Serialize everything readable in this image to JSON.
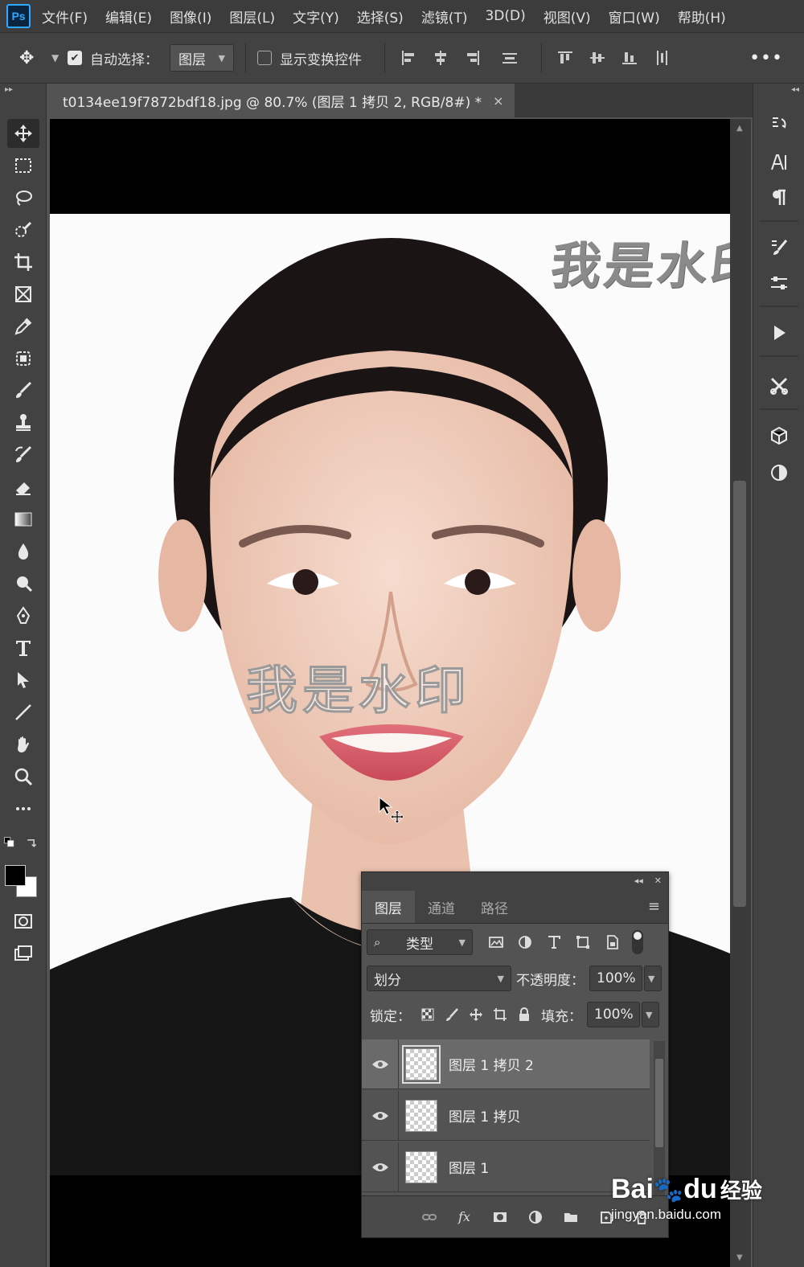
{
  "app": {
    "logo": "Ps"
  },
  "menu": [
    "文件(F)",
    "编辑(E)",
    "图像(I)",
    "图层(L)",
    "文字(Y)",
    "选择(S)",
    "滤镜(T)",
    "3D(D)",
    "视图(V)",
    "窗口(W)",
    "帮助(H)"
  ],
  "options": {
    "auto_select_label": "自动选择：",
    "auto_select_checked": true,
    "auto_select_target": "图层",
    "show_transform_label": "显示变换控件",
    "show_transform_checked": false,
    "more": "•••"
  },
  "document": {
    "tab_title": "t0134ee19f7872bdf18.jpg @ 80.7% (图层 1 拷贝 2, RGB/8#) *",
    "close": "×"
  },
  "canvas": {
    "watermark_top": "我是水印",
    "watermark_face": "我是水印"
  },
  "layers_panel": {
    "tabs": [
      "图层",
      "通道",
      "路径"
    ],
    "active_tab": 0,
    "filter_kind": "类型",
    "blend_mode": "划分",
    "opacity_label": "不透明度：",
    "opacity_value": "100%",
    "lock_label": "锁定：",
    "fill_label": "填充：",
    "fill_value": "100%",
    "layers": [
      {
        "name": "图层 1 拷贝 2",
        "visible": true,
        "selected": true
      },
      {
        "name": "图层 1 拷贝",
        "visible": true,
        "selected": false
      },
      {
        "name": "图层 1",
        "visible": true,
        "selected": false
      }
    ],
    "footer_fx": "fx"
  },
  "site_watermark": {
    "logo": "Bai",
    "logo_suffix": "du",
    "logo_cn": "经验",
    "url": "jingyan.baidu.com"
  },
  "colors": {
    "ps_blue": "#31a8ff",
    "ui_dark": "#424242",
    "ui_mid": "#535353",
    "foreground": "#000000",
    "background": "#ffffff"
  }
}
